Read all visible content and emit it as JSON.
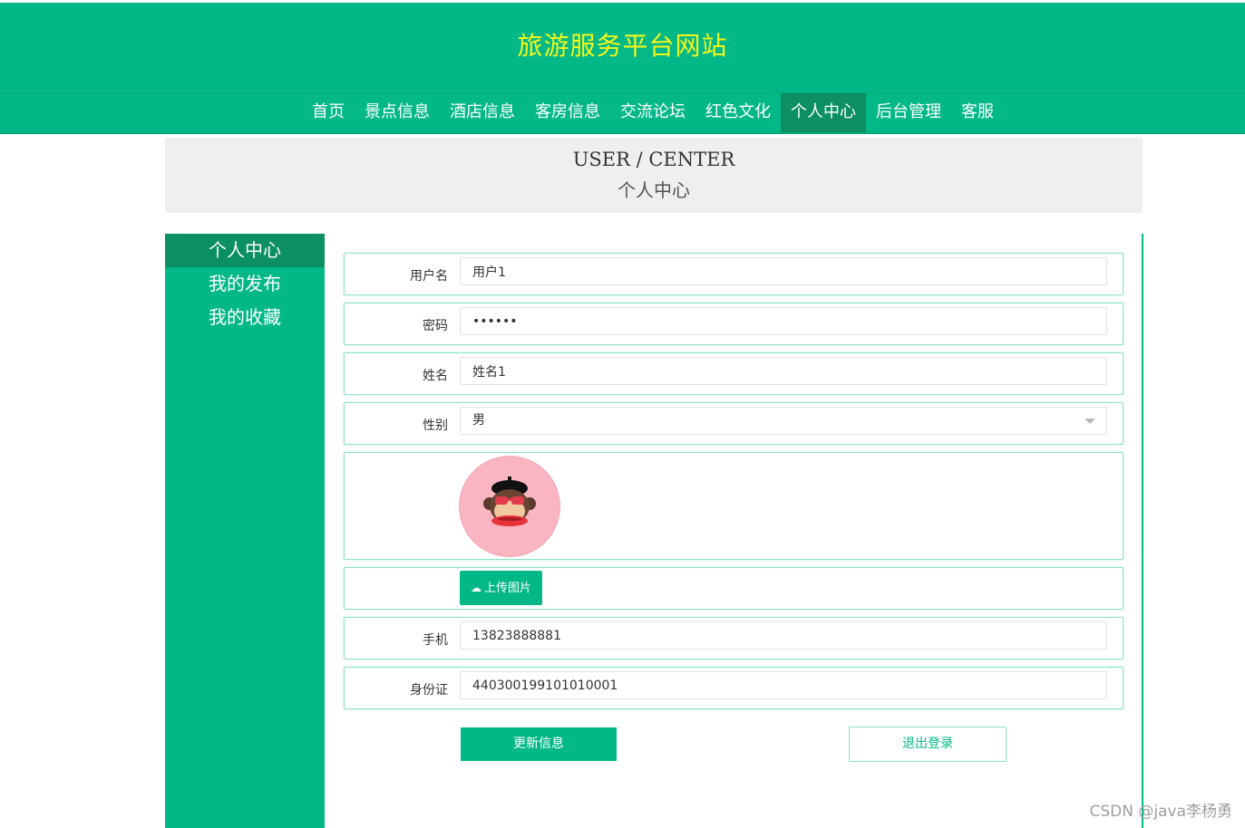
{
  "site": {
    "title": "旅游服务平台网站"
  },
  "nav": {
    "items": [
      {
        "label": "首页"
      },
      {
        "label": "景点信息"
      },
      {
        "label": "酒店信息"
      },
      {
        "label": "客房信息"
      },
      {
        "label": "交流论坛"
      },
      {
        "label": "红色文化"
      },
      {
        "label": "个人中心",
        "active": true
      },
      {
        "label": "后台管理"
      },
      {
        "label": "客服"
      }
    ]
  },
  "banner": {
    "en": "USER / CENTER",
    "zh": "个人中心"
  },
  "sidebar": {
    "items": [
      {
        "label": "个人中心",
        "active": true
      },
      {
        "label": "我的发布"
      },
      {
        "label": "我的收藏"
      }
    ]
  },
  "form": {
    "username": {
      "label": "用户名",
      "value": "用户1"
    },
    "password": {
      "label": "密码",
      "value": "••••••"
    },
    "name": {
      "label": "姓名",
      "value": "姓名1"
    },
    "gender": {
      "label": "性别",
      "value": "男"
    },
    "upload_label": "上传图片",
    "phone": {
      "label": "手机",
      "value": "13823888881"
    },
    "id_card": {
      "label": "身份证",
      "value": "440300199101010001"
    }
  },
  "buttons": {
    "update": "更新信息",
    "logout": "退出登录"
  },
  "watermark": "CSDN @java李杨勇",
  "colors": {
    "primary": "#03b887",
    "active": "#0b8f63",
    "title": "#f4f71a"
  }
}
